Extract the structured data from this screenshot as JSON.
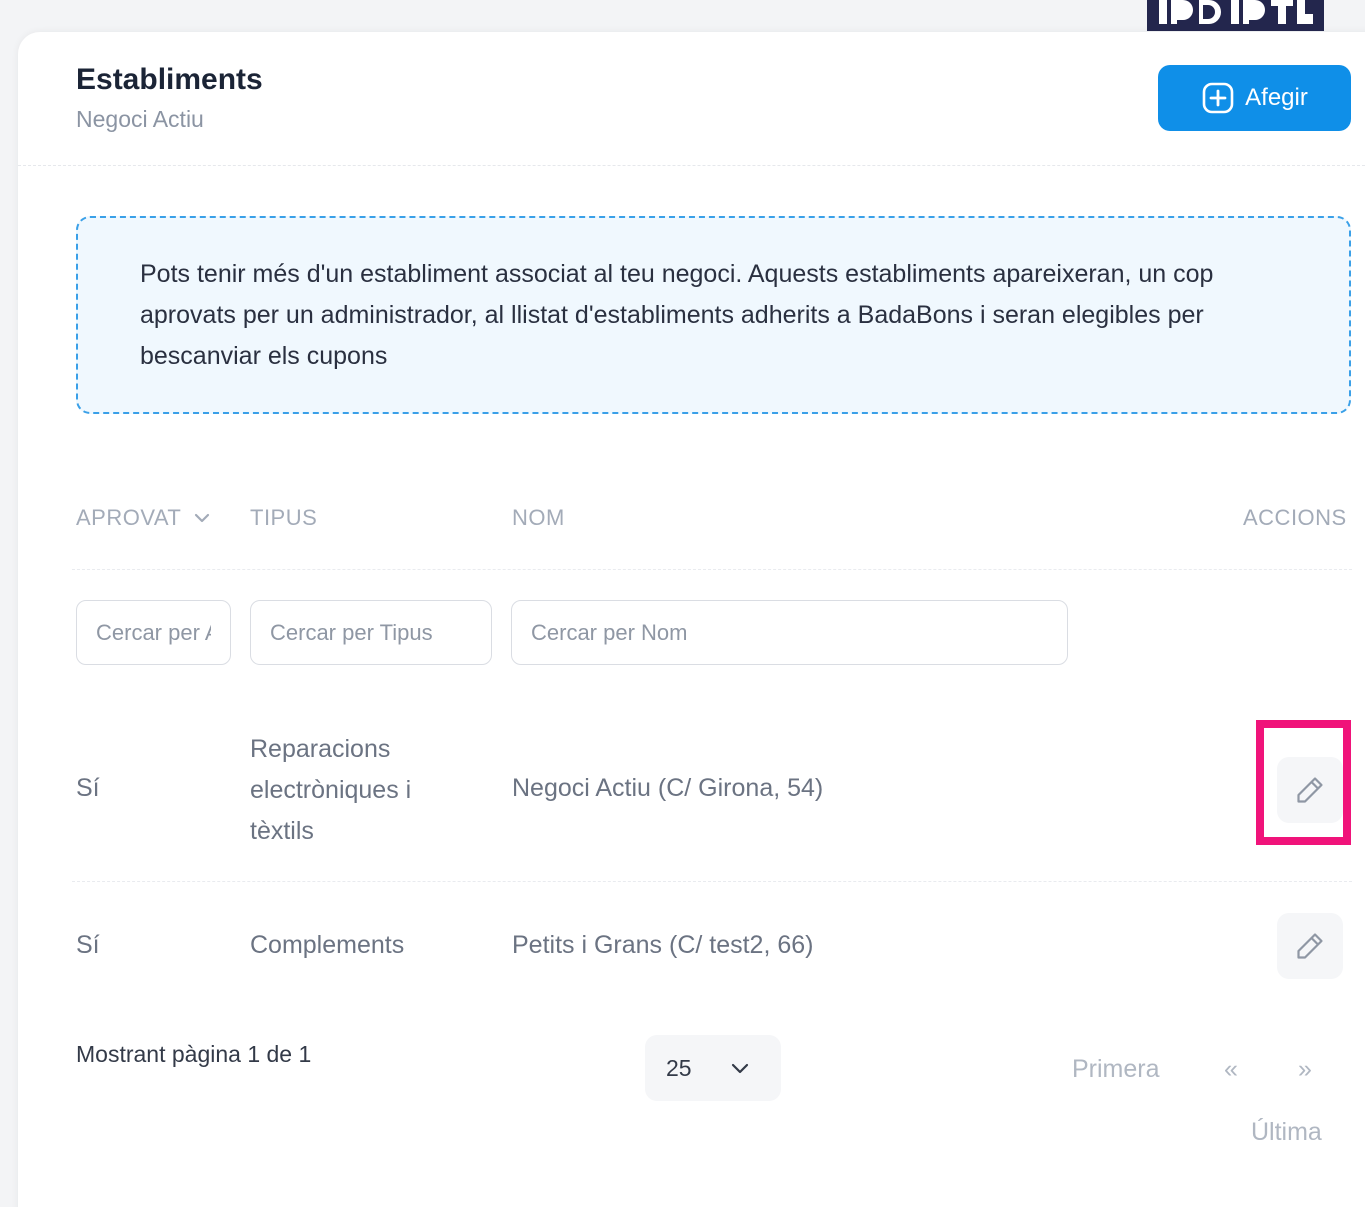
{
  "header": {
    "title": "Establiments",
    "subtitle": "Negoci Actiu",
    "add_label": "Afegir"
  },
  "notice": {
    "text": "Pots tenir més d'un establiment associat al teu negoci. Aquests establiments apareixeran, un cop aprovats per un administrador, al llistat d'establiments adherits a BadaBons i seran elegibles per bescanviar els cupons"
  },
  "table": {
    "columns": {
      "aprovat": "APROVAT",
      "tipus": "TIPUS",
      "nom": "NOM",
      "accions": "ACCIONS"
    },
    "filters": {
      "aprovat_placeholder": "Cercar per Aprovat",
      "tipus_placeholder": "Cercar per Tipus",
      "nom_placeholder": "Cercar per Nom"
    },
    "rows": [
      {
        "aprovat": "Sí",
        "tipus_lines": [
          "Reparacions",
          "electròniques i",
          "tèxtils"
        ],
        "nom": "Negoci Actiu (C/ Girona, 54)"
      },
      {
        "aprovat": "Sí",
        "tipus": "Complements",
        "nom": "Petits i Grans (C/ test2, 66)"
      }
    ]
  },
  "pagination": {
    "info": "Mostrant pàgina 1 de 1",
    "page_size": "25",
    "first": "Primera",
    "prev": "«",
    "next": "»",
    "last": "Última"
  },
  "icons": {
    "add": "plus-square-icon",
    "sort": "chevron-down-icon",
    "edit": "pencil-icon",
    "page_size": "chevron-down-icon"
  },
  "colors": {
    "accent": "#0f8fe8",
    "highlight": "#f0137a",
    "notice_bg": "#f0f8fe",
    "notice_border": "#3aa0e8"
  }
}
